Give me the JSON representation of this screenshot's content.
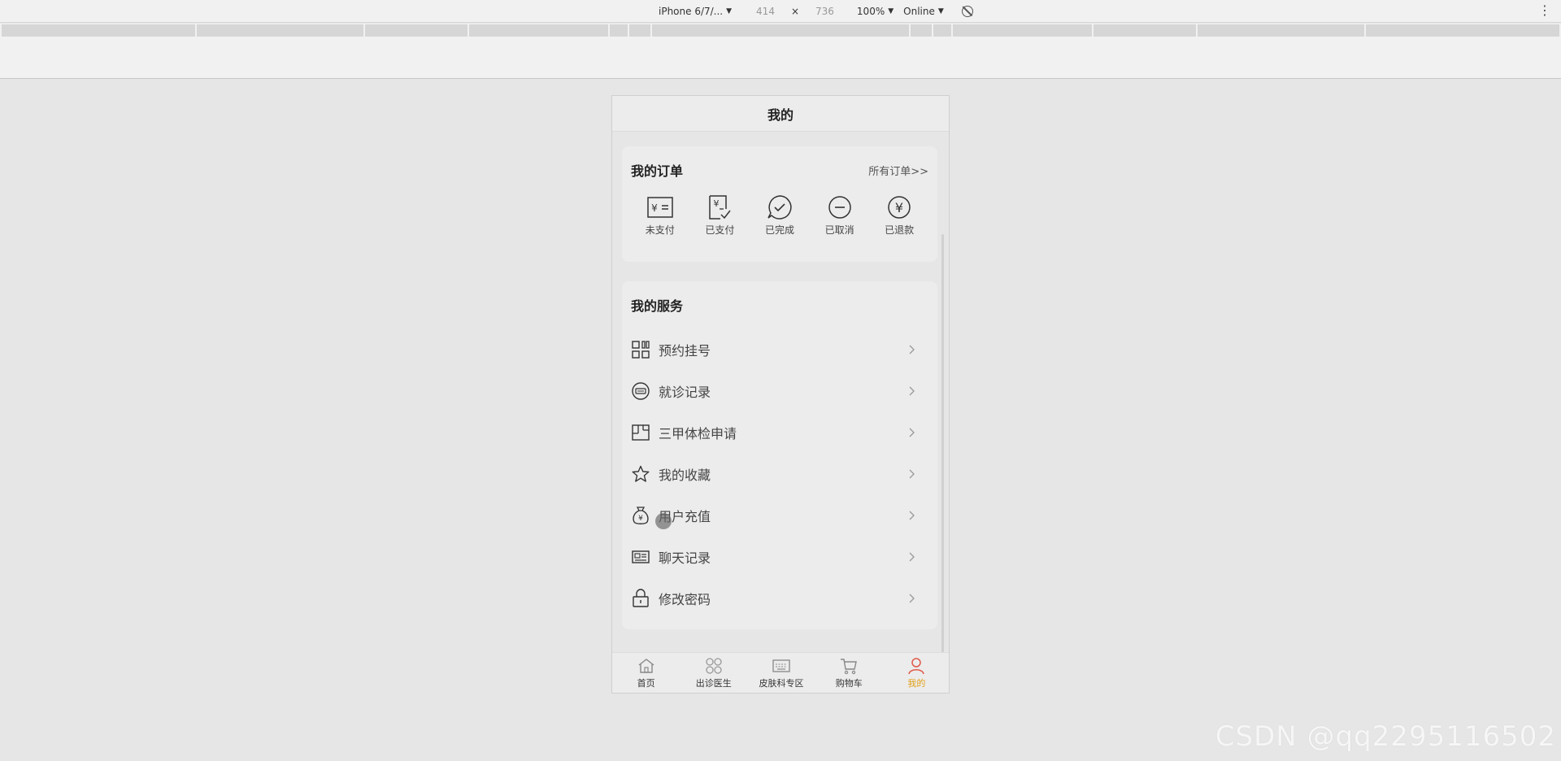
{
  "devtools": {
    "device": "iPhone 6/7/...",
    "width": "414",
    "times": "×",
    "height": "736",
    "zoom": "100%",
    "network": "Online",
    "caret": "▼",
    "more": "⋮"
  },
  "page": {
    "title": "我的"
  },
  "orders": {
    "title": "我的订单",
    "all_link": "所有订单>>",
    "items": [
      {
        "label": "未支付",
        "icon": "unpaid-icon"
      },
      {
        "label": "已支付",
        "icon": "paid-icon"
      },
      {
        "label": "已完成",
        "icon": "completed-icon"
      },
      {
        "label": "已取消",
        "icon": "cancelled-icon"
      },
      {
        "label": "已退款",
        "icon": "refunded-icon"
      }
    ]
  },
  "services": {
    "title": "我的服务",
    "items": [
      {
        "label": "预约挂号",
        "icon": "qr-grid-icon"
      },
      {
        "label": "就诊记录",
        "icon": "record-circle-icon"
      },
      {
        "label": "三甲体检申请",
        "icon": "layout-icon"
      },
      {
        "label": "我的收藏",
        "icon": "star-icon"
      },
      {
        "label": "用户充值",
        "icon": "money-bag-icon"
      },
      {
        "label": "聊天记录",
        "icon": "id-card-icon"
      },
      {
        "label": "修改密码",
        "icon": "lock-icon"
      }
    ]
  },
  "tabbar": {
    "items": [
      {
        "label": "首页",
        "icon": "home-icon",
        "active": false
      },
      {
        "label": "出诊医生",
        "icon": "clover-icon",
        "active": false
      },
      {
        "label": "皮肤科专区",
        "icon": "keyboard-icon",
        "active": false
      },
      {
        "label": "购物车",
        "icon": "cart-icon",
        "active": false
      },
      {
        "label": "我的",
        "icon": "user-icon",
        "active": true
      }
    ]
  },
  "colors": {
    "active_tab": "#e3a018",
    "background": "#e6e6e6",
    "card": "#ececec"
  },
  "watermark": "CSDN @qq2295116502"
}
